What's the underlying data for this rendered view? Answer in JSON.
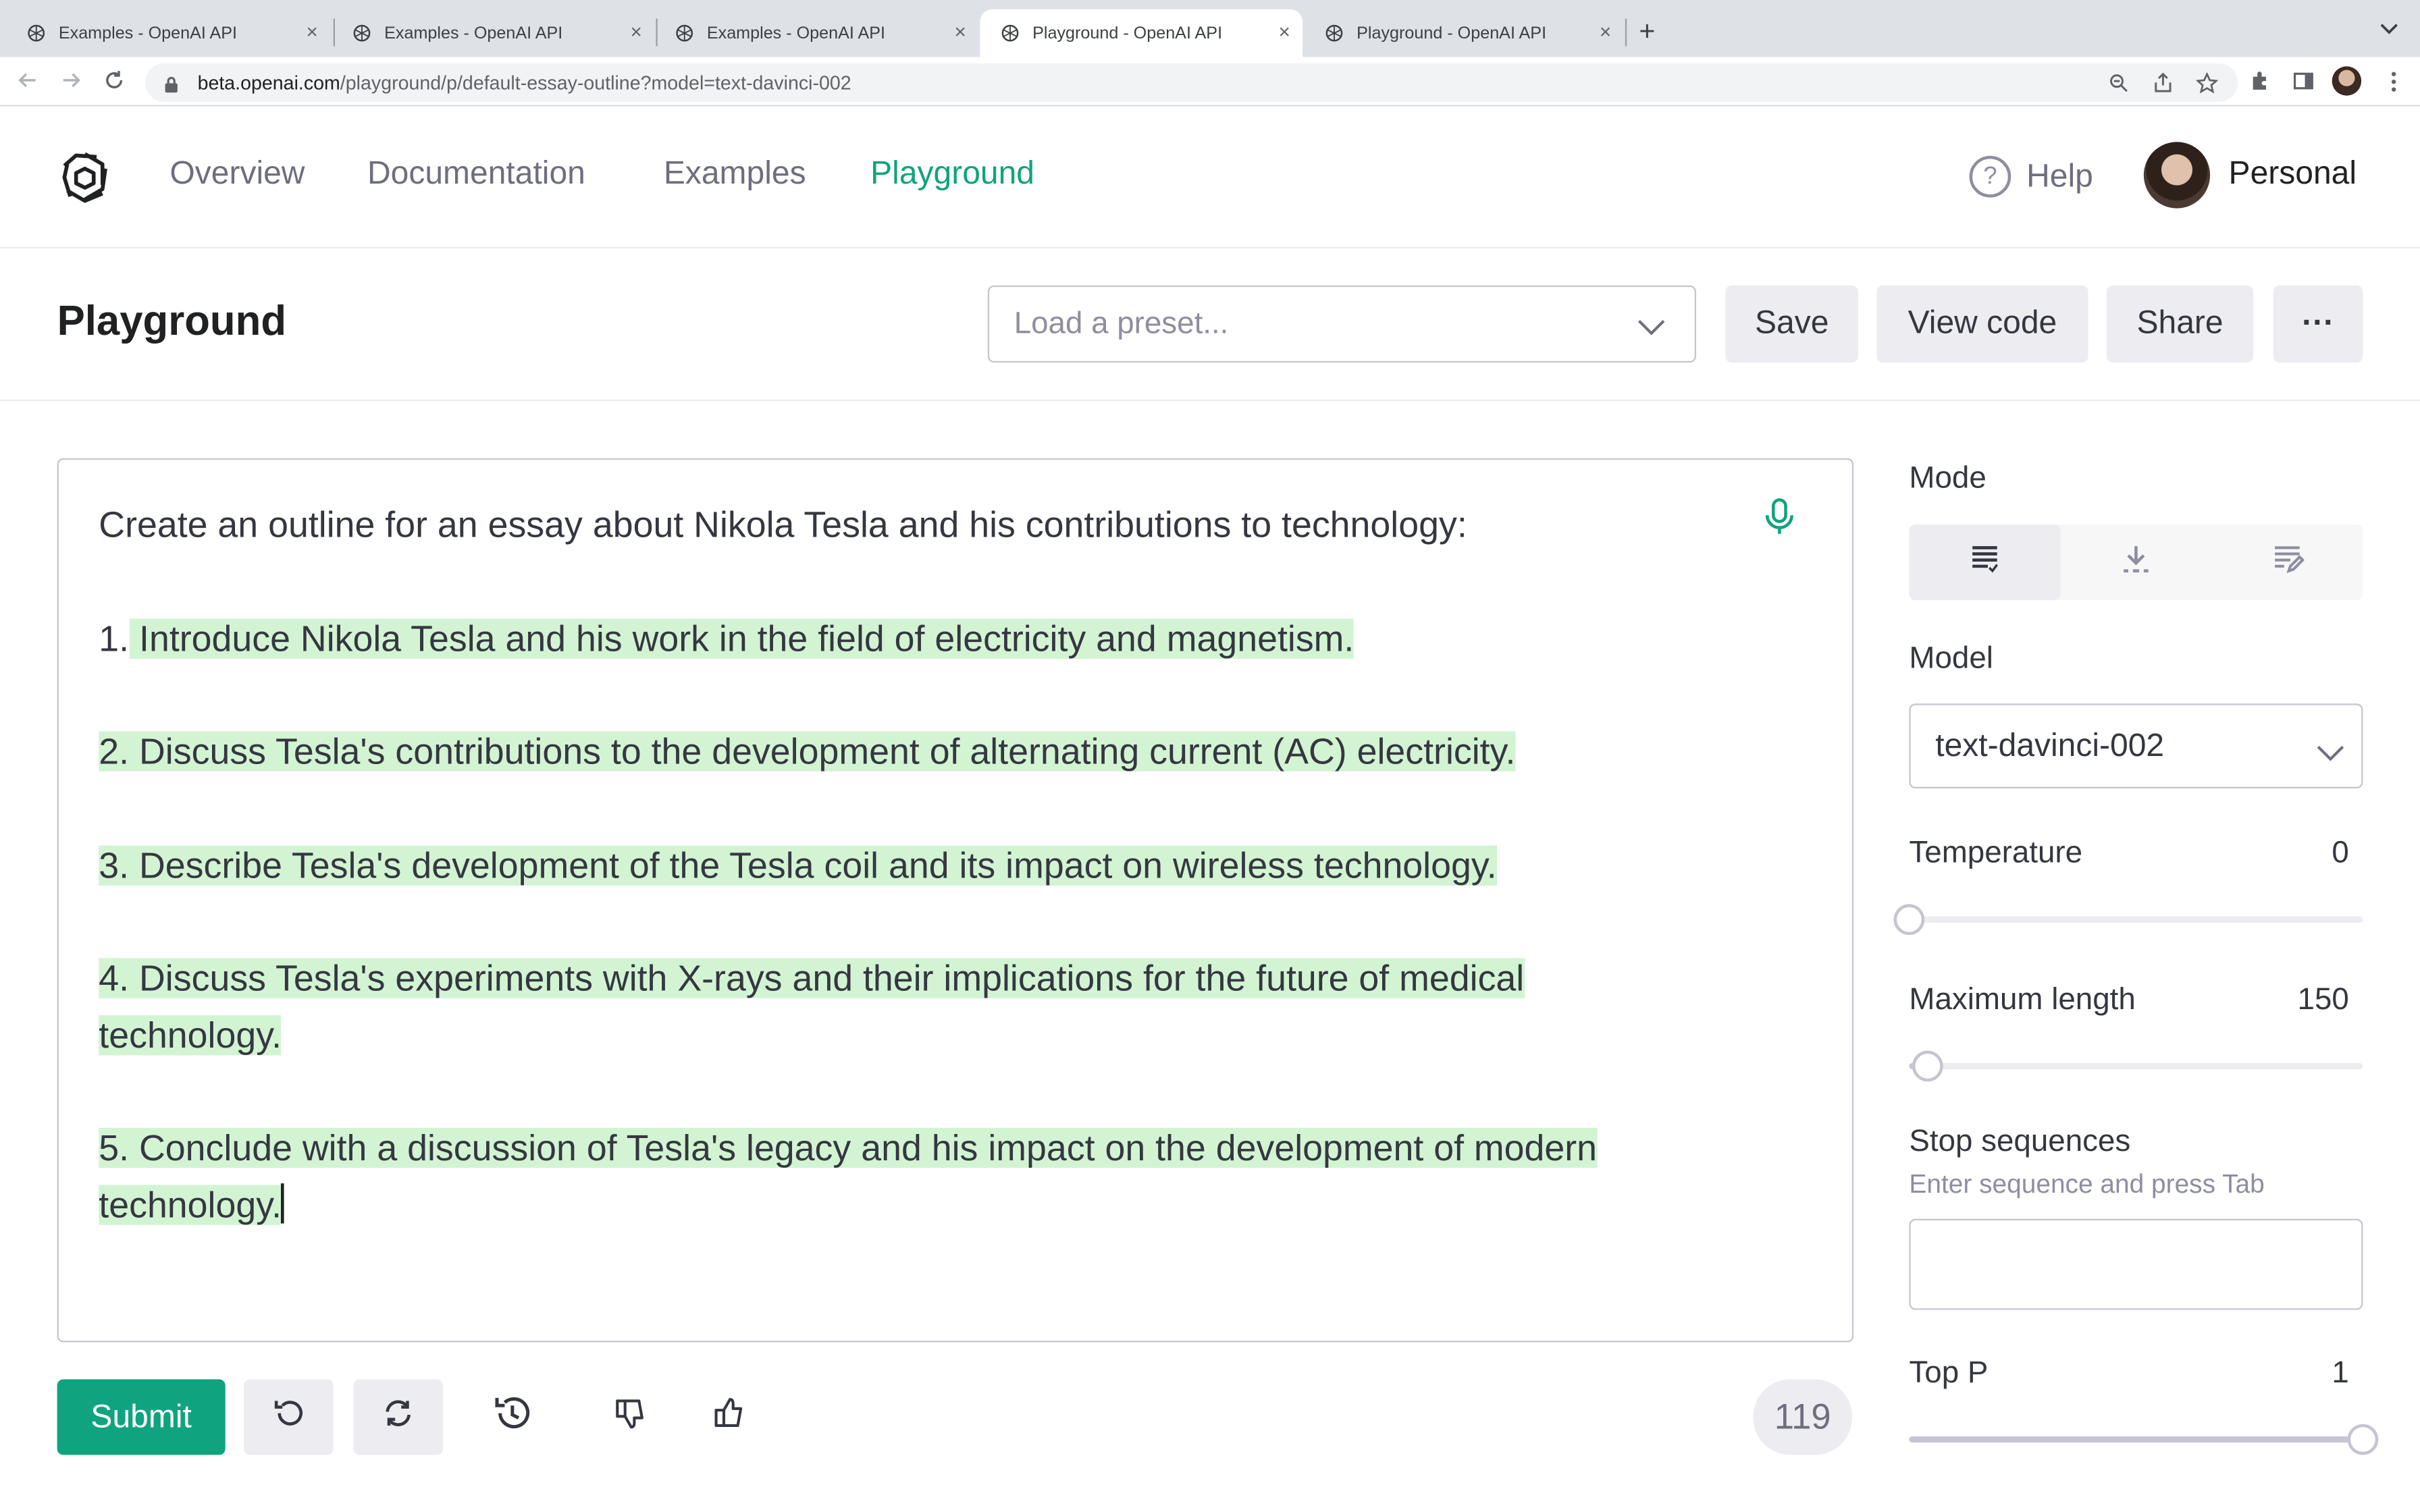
{
  "browser": {
    "tabs": [
      {
        "title": "Examples - OpenAI API",
        "active": false
      },
      {
        "title": "Examples - OpenAI API",
        "active": false
      },
      {
        "title": "Examples - OpenAI API",
        "active": false
      },
      {
        "title": "Playground - OpenAI API",
        "active": true
      },
      {
        "title": "Playground - OpenAI API",
        "active": false
      }
    ],
    "close_glyph": "×",
    "new_tab_glyph": "+",
    "url_host": "beta.openai.com",
    "url_path": "/playground/p/default-essay-outline?model=text-davinci-002"
  },
  "nav": {
    "links": [
      "Overview",
      "Documentation",
      "Examples",
      "Playground"
    ],
    "active": "Playground",
    "help": "Help",
    "help_glyph": "?",
    "account": "Personal"
  },
  "toolbar": {
    "title": "Playground",
    "preset_placeholder": "Load a preset...",
    "save": "Save",
    "view_code": "View code",
    "share": "Share",
    "more": "···"
  },
  "editor": {
    "prompt": "Create an outline for an essay about Nikola Tesla and his contributions to technology:",
    "item1_prefix": "1.",
    "item1": " Introduce Nikola Tesla and his work in the field of electricity and magnetism.",
    "item2": "2. Discuss Tesla's contributions to the development of alternating current (AC) electricity.",
    "item3": "3. Describe Tesla's development of the Tesla coil and its impact on wireless technology.",
    "item4_a": "4. Discuss Tesla's experiments with X-rays and their implications for the future of medical",
    "item4_b": "technology.",
    "item5_a": "5. Conclude with a discussion of Tesla's legacy and his impact on the development of modern",
    "item5_b": "technology."
  },
  "actions": {
    "submit": "Submit",
    "token_count": "119"
  },
  "settings": {
    "mode_label": "Mode",
    "model_label": "Model",
    "model_value": "text-davinci-002",
    "temperature_label": "Temperature",
    "temperature_value": "0",
    "temperature_fraction": 0,
    "max_length_label": "Maximum length",
    "max_length_value": "150",
    "max_length_fraction": 0.04,
    "stop_label": "Stop sequences",
    "stop_hint": "Enter sequence and press Tab",
    "top_p_label": "Top P",
    "top_p_value": "1",
    "top_p_fraction": 1
  },
  "colors": {
    "accent": "#10a37f",
    "highlight": "#d2f4d3"
  }
}
